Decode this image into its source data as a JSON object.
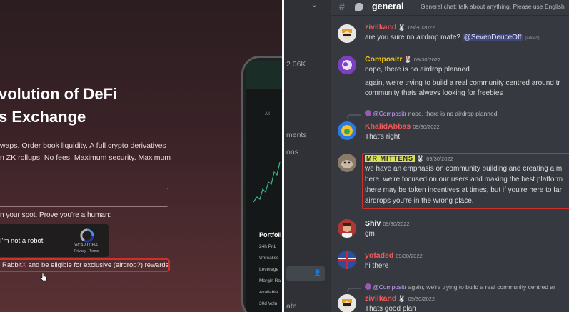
{
  "website": {
    "hero_line1": "volution of DeFi",
    "hero_line2": "s Exchange",
    "desc_line1": "waps. Order book liquidity. A full crypto derivatives",
    "desc_line2": "n ZK rollups. No fees. Maximum security. Maximum",
    "prove_text": "n your spot. Prove you're a human:",
    "captcha_label": "I'm not a robot",
    "captcha_brand": "reCAPTCHA",
    "captcha_links": "Privacy - Terms",
    "terms_pre": "Rabbit",
    "terms_x": "X",
    "terms_post": " and be eligible for exclusive (airdrop?) rewards",
    "phone": {
      "tab": "All",
      "portfolio_title": "Portfoli",
      "rows": [
        "24h PnL",
        "Unrealise",
        "Leverage",
        "Margin Ra",
        "Available",
        "30d Volu"
      ]
    }
  },
  "sidebar_fragment": {
    "items": [
      "2.06K",
      "ments",
      "ons",
      "ate"
    ]
  },
  "channel": {
    "name": "general",
    "topic": "General chat; talk about anything. Please use English"
  },
  "messages": [
    {
      "user": "zivilkand",
      "color": "#f05a5a",
      "badge": "🐰",
      "time": "09/30/2022",
      "lines": [
        "are you sure no airdrop mate?"
      ],
      "mention": "@SevenDeuceOff",
      "edited": "(edited)"
    },
    {
      "user": "Compositr",
      "color": "#f1c40f",
      "badge": "🐰",
      "time": "09/30/2022",
      "lines": [
        "nope, there is no airdrop planned",
        "again, we're trying to build a real community centred around tr",
        "community thats always looking for freebies"
      ]
    },
    {
      "reply_user": "@Compositr",
      "reply_text": " nope, there is no airdrop planned",
      "user": "KhalidAbbas",
      "color": "#f05a5a",
      "time": "09/30/2022",
      "lines": [
        "That's right"
      ]
    },
    {
      "user": "MR MITTENS",
      "color": "#dbe34a",
      "badge": "🐰",
      "time": "09/30/2022",
      "lines": [
        "we have an emphasis on community building and creating a m",
        "here. we're focused on our users and making the best platform",
        "there may be token incentives at times, but if you're here to far",
        "airdrops you're in the wrong place."
      ]
    },
    {
      "user": "Shiv",
      "color": "#ffffff",
      "time": "09/30/2022",
      "lines": [
        "gm"
      ]
    },
    {
      "user": "yofaded",
      "color": "#f05a5a",
      "time": "09/30/2022",
      "lines": [
        "hi there"
      ]
    },
    {
      "reply_user": "@Compositr",
      "reply_text": " again, we're trying to build a real community centred ar",
      "user": "zivilkand",
      "color": "#f05a5a",
      "badge": "🐰",
      "time": "09/30/2022",
      "lines": [
        "Thats good plan"
      ]
    }
  ]
}
